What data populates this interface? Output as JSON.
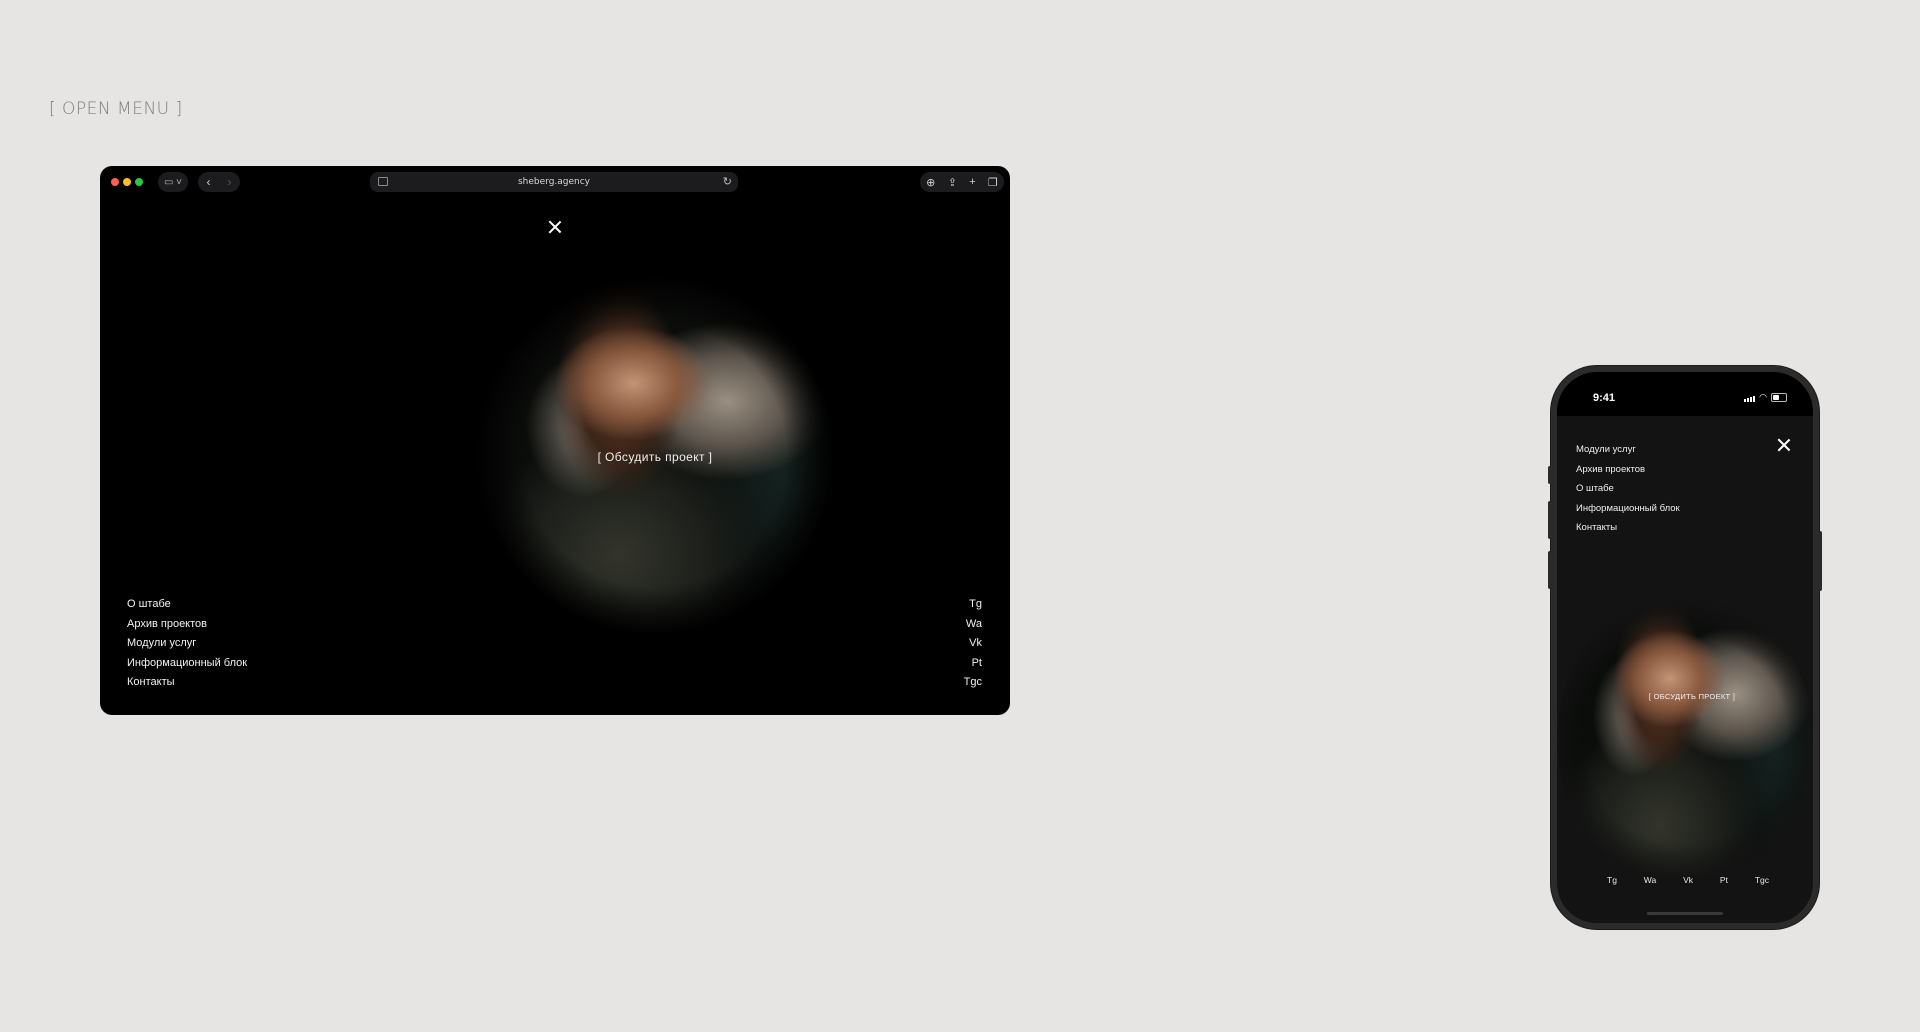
{
  "page": {
    "label": "[ OPEN MENU ]"
  },
  "desktop": {
    "url": "sheberg.agency",
    "cta": "[ Обсудить проект ]",
    "menu": [
      "О штабе",
      "Архив проектов",
      "Модули услуг",
      "Информационный блок",
      "Контакты"
    ],
    "socials": [
      "Tg",
      "Wa",
      "Vk",
      "Pt",
      "Tgc"
    ]
  },
  "mobile": {
    "time": "9:41",
    "cta": "[ ОБСУДИТЬ ПРОЕКТ ]",
    "menu": [
      "Модули услуг",
      "Архив проектов",
      "О штабе",
      "Информационный блок",
      "Контакты"
    ],
    "socials": [
      "Tg",
      "Wa",
      "Vk",
      "Pt",
      "Tgc"
    ]
  },
  "icons": [
    "close-icon",
    "sidebar-icon",
    "back-icon",
    "forward-icon",
    "reload-icon",
    "download-icon",
    "share-icon",
    "new-tab-icon",
    "tabs-icon",
    "signal-icon",
    "wifi-icon",
    "battery-icon"
  ],
  "colors": {
    "background": "#e6e5e3",
    "screen": "#000000",
    "text": "#f2f2f2",
    "label": "#7d7d7d"
  }
}
